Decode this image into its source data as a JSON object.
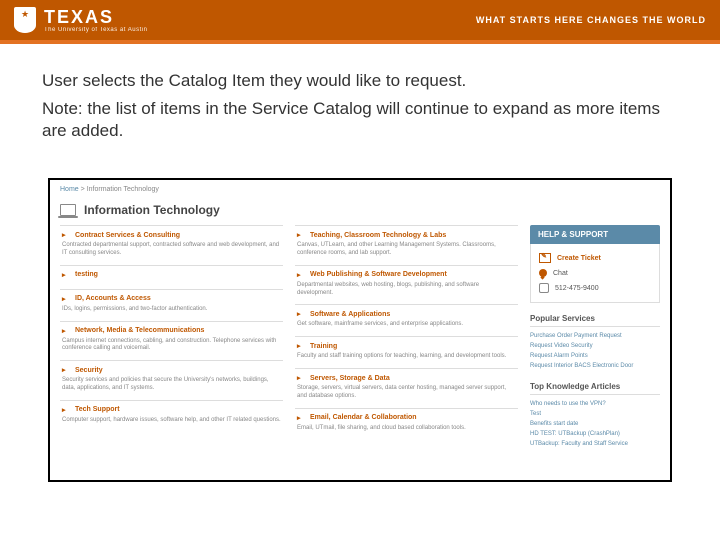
{
  "header": {
    "brand": "TEXAS",
    "brand_sub": "The University of Texas at Austin",
    "tagline": "WHAT STARTS HERE CHANGES THE WORLD"
  },
  "instruction": "User selects the Catalog Item they would like to request.",
  "note": "Note: the list of items in the Service Catalog will continue to expand as more items are added.",
  "catalog": {
    "breadcrumb_home": "Home",
    "breadcrumb_sep": ">",
    "breadcrumb_current": "Information Technology",
    "title": "Information Technology",
    "left": [
      {
        "t": "Contract Services & Consulting",
        "d": "Contracted departmental support, contracted software and web development, and IT consulting services."
      },
      {
        "t": "testing",
        "d": ""
      },
      {
        "t": "ID, Accounts & Access",
        "d": "IDs, logins, permissions, and two-factor authentication."
      },
      {
        "t": "Network, Media & Telecommunications",
        "d": "Campus internet connections, cabling, and construction. Telephone services with conference calling and voicemail."
      },
      {
        "t": "Security",
        "d": "Security services and policies that secure the University's networks, buildings, data, applications, and IT systems."
      },
      {
        "t": "Tech Support",
        "d": "Computer support, hardware issues, software help, and other IT related questions."
      }
    ],
    "right": [
      {
        "t": "Teaching, Classroom Technology & Labs",
        "d": "Canvas, UTLearn, and other Learning Management Systems. Classrooms, conference rooms, and lab support."
      },
      {
        "t": "Web Publishing & Software Development",
        "d": "Departmental websites, web hosting, blogs, publishing, and software development."
      },
      {
        "t": "Software & Applications",
        "d": "Get software, mainframe services, and enterprise applications."
      },
      {
        "t": "Training",
        "d": "Faculty and staff training options for teaching, learning, and development tools."
      },
      {
        "t": "Servers, Storage & Data",
        "d": "Storage, servers, virtual servers, data center hosting, managed server support, and database options."
      },
      {
        "t": "Email, Calendar & Collaboration",
        "d": "Email, UTmail, file sharing, and cloud based collaboration tools."
      }
    ],
    "help": {
      "title": "HELP & SUPPORT",
      "ticket": "Create Ticket",
      "chat": "Chat",
      "phone": "512-475-9400"
    },
    "popular": {
      "title": "Popular Services",
      "items": [
        "Purchase Order Payment Request",
        "Request Video Security",
        "Request Alarm Points",
        "Request Interior BACS Electronic Door"
      ]
    },
    "kb": {
      "title": "Top Knowledge Articles",
      "items": [
        "Who needs to use the VPN?",
        "Test",
        "Benefits start date",
        "HD TEST: UTBackup (CrashPlan)",
        "UTBackup: Faculty and Staff Service"
      ]
    }
  }
}
